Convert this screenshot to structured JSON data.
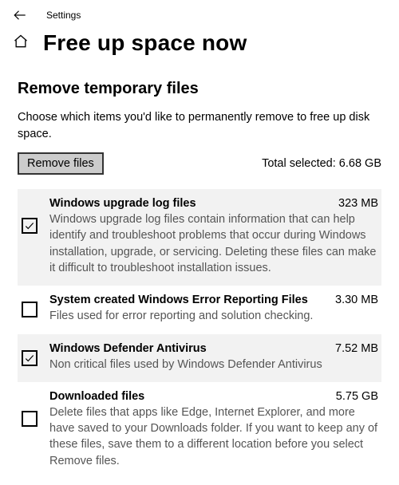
{
  "breadcrumb": "Settings",
  "page_title": "Free up space now",
  "section": {
    "heading": "Remove temporary files",
    "description": "Choose which items you'd like to permanently remove to free up disk space.",
    "remove_button": "Remove files",
    "total_label": "Total selected: 6.68 GB"
  },
  "items": [
    {
      "title": "Windows upgrade log files",
      "size": "323 MB",
      "description": "Windows upgrade log files contain information that can help identify and troubleshoot problems that occur during Windows installation, upgrade, or servicing.  Deleting these files can make it difficult to troubleshoot installation issues.",
      "checked": true
    },
    {
      "title": "System created Windows Error Reporting Files",
      "size": "3.30 MB",
      "description": "Files used for error reporting and solution checking.",
      "checked": false
    },
    {
      "title": "Windows Defender Antivirus",
      "size": "7.52 MB",
      "description": "Non critical files used by Windows Defender Antivirus",
      "checked": true
    },
    {
      "title": "Downloaded files",
      "size": "5.75 GB",
      "description": "Delete files that apps like Edge, Internet Explorer, and more have saved to your Downloads folder. If you want to keep any of these files, save them to a different location before you select Remove files.",
      "checked": false
    }
  ]
}
